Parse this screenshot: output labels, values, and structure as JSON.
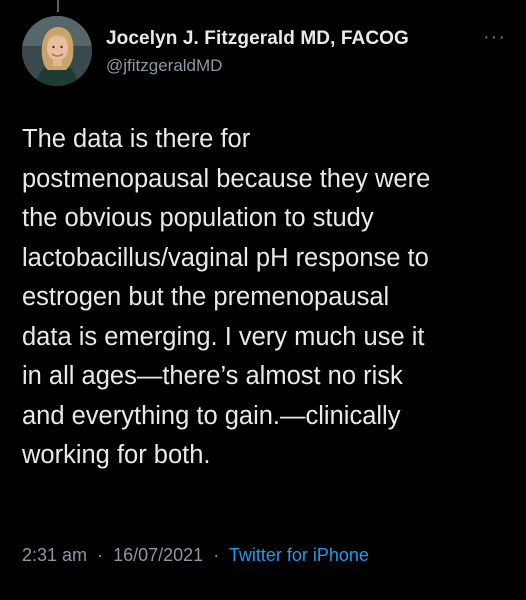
{
  "colors": {
    "background": "#000000",
    "text": "#e7e9ea",
    "secondary_text": "#8b98a5",
    "link": "#1d9bf0"
  },
  "author": {
    "name": "Jocelyn J. Fitzgerald MD, FACOG",
    "handle": "@jfitzgeraldMD",
    "avatar_icon": "profile-photo"
  },
  "more_icon": "···",
  "tweet": {
    "lines": [
      "The data is there for",
      "postmenopausal because they were",
      "the obvious population to study",
      "lactobacillus/vaginal pH response to",
      "estrogen but the premenopausal",
      "data is emerging. I very much use it",
      "in all ages—there’s almost no risk",
      "and everything to gain.—clinically",
      "working for both."
    ]
  },
  "meta": {
    "time": "2:31 am",
    "separator": "·",
    "date": "16/07/2021",
    "source": "Twitter for iPhone"
  }
}
